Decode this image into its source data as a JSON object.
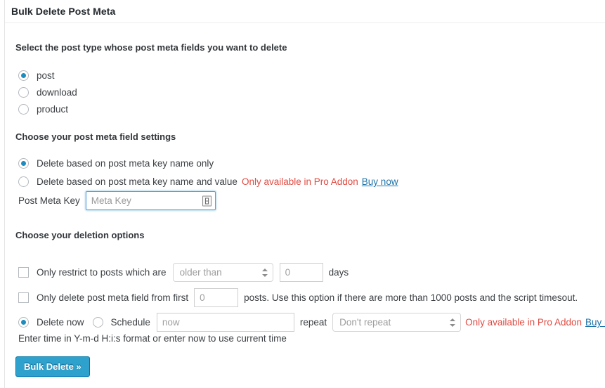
{
  "panel": {
    "title": "Bulk Delete Post Meta"
  },
  "post_type_section": {
    "heading": "Select the post type whose post meta fields you want to delete",
    "options": [
      {
        "label": "post",
        "checked": true
      },
      {
        "label": "download",
        "checked": false
      },
      {
        "label": "product",
        "checked": false
      }
    ]
  },
  "meta_field_section": {
    "heading": "Choose your post meta field settings",
    "options": [
      {
        "label": "Delete based on post meta key name only",
        "checked": true
      },
      {
        "label": "Delete based on post meta key name and value",
        "checked": false
      }
    ],
    "pro_note": "Only available in Pro Addon",
    "buy_now": "Buy now",
    "meta_key_label": "Post Meta Key",
    "meta_key_value": "",
    "meta_key_placeholder": "Meta Key",
    "autofill_icon": "contact-card-icon"
  },
  "deletion_section": {
    "heading": "Choose your deletion options",
    "restrict": {
      "checked": false,
      "label": "Only restrict to posts which are",
      "select_value": "older than",
      "days_value": "",
      "days_placeholder": "0",
      "days_label": "days"
    },
    "limit": {
      "checked": false,
      "label_before": "Only delete post meta field from first",
      "count_value": "",
      "count_placeholder": "0",
      "label_after": "posts. Use this option if there are more than 1000 posts and the script timesout."
    },
    "schedule": {
      "delete_now_label": "Delete now",
      "delete_now_checked": true,
      "schedule_label": "Schedule",
      "schedule_checked": false,
      "time_value": "",
      "time_placeholder": "now",
      "repeat_label": "repeat",
      "repeat_value": "Don't repeat",
      "pro_note": "Only available in Pro Addon",
      "buy_now": "Buy now"
    },
    "hint": "Enter time in Y-m-d H:i:s format or enter now to use current time"
  },
  "submit": {
    "label": "Bulk Delete »"
  },
  "colors": {
    "accent": "#2ea2cc",
    "radio_dot": "#1e8cbe",
    "pro_red": "#e04a41",
    "link_blue": "#1e73a8",
    "focus_blue": "#5b9dd9",
    "border": "#e5e5e5",
    "text": "#32373c"
  }
}
